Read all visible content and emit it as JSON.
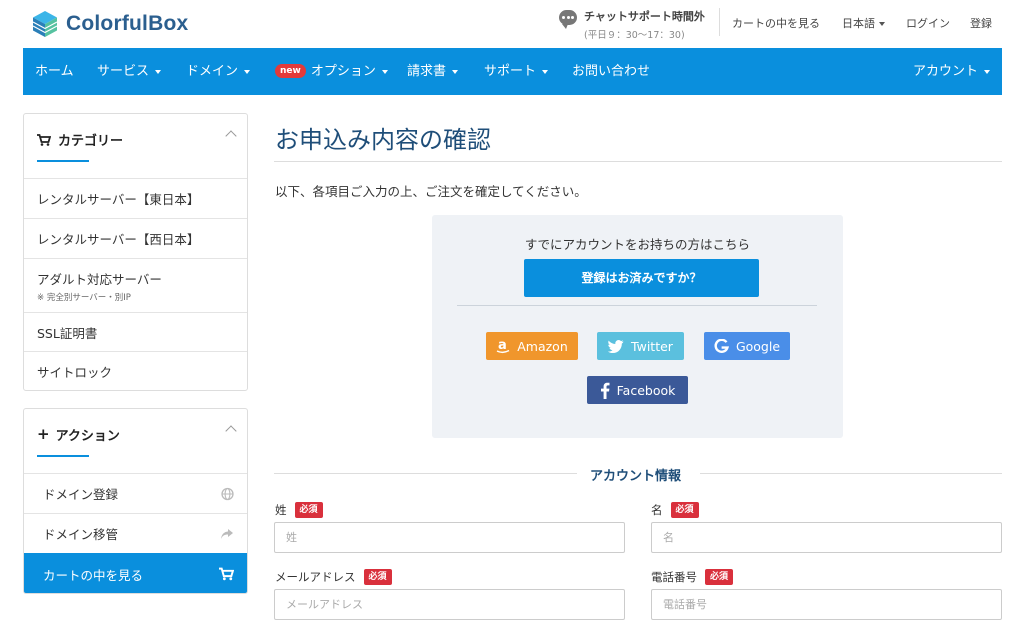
{
  "header": {
    "logo_text": "ColorfulBox",
    "chat_title": "チャットサポート時間外",
    "chat_hours": "(平日９：30～17：30)",
    "links": {
      "cart": "カートの中を見る",
      "language": "日本語",
      "login": "ログイン",
      "register": "登録"
    }
  },
  "nav": {
    "home": "ホーム",
    "services": "サービス",
    "domain": "ドメイン",
    "new_badge": "new",
    "options": "オプション",
    "billing": "請求書",
    "support": "サポート",
    "contact": "お問い合わせ",
    "account": "アカウント"
  },
  "sidebar": {
    "categories": {
      "title": "カテゴリー",
      "items": [
        {
          "label": "レンタルサーバー【東日本】"
        },
        {
          "label": "レンタルサーバー【西日本】"
        },
        {
          "label": "アダルト対応サーバー",
          "note": "※ 完全別サーバー・別IP"
        },
        {
          "label": "SSL証明書"
        },
        {
          "label": "サイトロック"
        }
      ]
    },
    "actions": {
      "title": "アクション",
      "items": [
        {
          "label": "ドメイン登録",
          "icon": "globe-icon"
        },
        {
          "label": "ドメイン移管",
          "icon": "share-icon"
        },
        {
          "label": "カートの中を見る",
          "icon": "cart-icon"
        }
      ]
    }
  },
  "main": {
    "title": "お申込み内容の確認",
    "intro": "以下、各項目ご入力の上、ご注文を確定してください。",
    "login_box": {
      "lead": "すでにアカウントをお持ちの方はこちら",
      "button": "登録はお済みですか？",
      "social": {
        "amazon": "Amazon",
        "twitter": "Twitter",
        "google": "Google",
        "facebook": "Facebook"
      }
    },
    "account_section": {
      "title": "アカウント情報",
      "required_badge": "必須",
      "fields": {
        "last_name": {
          "label": "姓",
          "placeholder": "姓"
        },
        "first_name": {
          "label": "名",
          "placeholder": "名"
        },
        "email": {
          "label": "メールアドレス",
          "placeholder": "メールアドレス"
        },
        "phone": {
          "label": "電話番号",
          "placeholder": "電話番号"
        }
      }
    }
  },
  "colors": {
    "primary": "#0a8fdd",
    "title": "#1f4e79",
    "required": "#d9303c",
    "amazon": "#f0962c",
    "twitter": "#5bc0de",
    "google": "#4a8ee8",
    "facebook": "#3b5998"
  }
}
